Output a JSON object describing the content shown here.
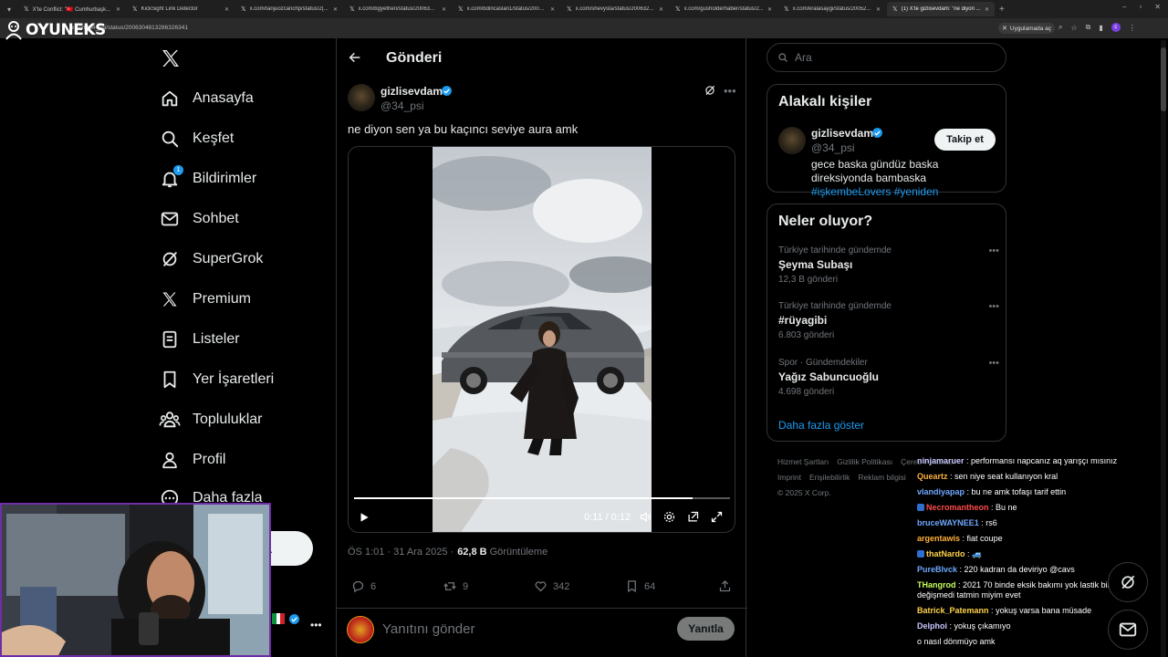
{
  "browser": {
    "tabs": [
      {
        "title": "X'te Conflict: \"🇹🇷 Cumhurbaşk...",
        "active": false
      },
      {
        "title": "KickSight Link Detector",
        "active": false
      },
      {
        "title": "x.com/tanjuozcanchp/status/2(...",
        "active": false
      },
      {
        "title": "x.com/bgyetheri/status/20063...",
        "active": false
      },
      {
        "title": "x.com/bdincaslan1/status/2006...",
        "active": false
      },
      {
        "title": "x.com/shevysta/status/200632...",
        "active": false
      },
      {
        "title": "x.com/gusholderhaber/status/2...",
        "active": false
      },
      {
        "title": "x.com/kralasaygi/status/20052...",
        "active": false
      },
      {
        "title": "(1) X'te gizlisevdam: \"ne diyon ...",
        "active": true
      }
    ],
    "url": "x.com/34_psi/status/2006304813286326341",
    "app_chip": "Uygulamada aç"
  },
  "stream": {
    "logo_text": "OYUNEKS"
  },
  "nav": {
    "items": [
      {
        "label": "Anasayfa",
        "icon": "home-icon"
      },
      {
        "label": "Keşfet",
        "icon": "search-icon"
      },
      {
        "label": "Bildirimler",
        "icon": "bell-icon",
        "badge": "1"
      },
      {
        "label": "Sohbet",
        "icon": "mail-icon"
      },
      {
        "label": "SuperGrok",
        "icon": "grok-icon"
      },
      {
        "label": "Premium",
        "icon": "x-icon"
      },
      {
        "label": "Listeler",
        "icon": "list-icon"
      },
      {
        "label": "Yer İşaretleri",
        "icon": "bookmark-icon"
      },
      {
        "label": "Topluluklar",
        "icon": "communities-icon"
      },
      {
        "label": "Profil",
        "icon": "profile-icon"
      },
      {
        "label": "Daha fazla",
        "icon": "more-circle-icon"
      }
    ],
    "post_button_partial": "a",
    "account_more": "•••"
  },
  "post": {
    "header_title": "Gönderi",
    "author_name": "gizlisevdam",
    "author_handle": "@34_psi",
    "text": "ne diyon sen ya bu kaçıncı seviye aura amk",
    "video": {
      "current_time": "0:11",
      "separator": "/",
      "duration": "0:12",
      "progress": 0.9
    },
    "time": "ÖS 1:01 · 31 Ara 2025 ·",
    "views": "62,8 B",
    "views_label": "Görüntüleme",
    "stats": {
      "replies": "6",
      "reposts": "9",
      "likes": "342",
      "bookmarks": "64"
    },
    "reply_placeholder": "Yanıtını gönder",
    "reply_button": "Yanıtla"
  },
  "sidebar": {
    "search_placeholder": "Ara",
    "related_title": "Alakalı kişiler",
    "related": {
      "name": "gizlisevdam",
      "handle": "@34_psi",
      "follow_label": "Takip et",
      "bio_text": "gece baska gündüz baska direksiyonda bambaska ",
      "bio_tag1": "#işkembeLovers",
      "bio_tag2": "#yeniden"
    },
    "trends_title": "Neler oluyor?",
    "trends": [
      {
        "context": "Türkiye tarihinde gündemde",
        "name": "Şeyma Subaşı",
        "count": "12,3 B gönderi"
      },
      {
        "context": "Türkiye tarihinde gündemde",
        "name": "#rüyagibi",
        "count": "6.803 gönderi"
      },
      {
        "context": "Spor · Gündemdekiler",
        "name": "Yağız Sabuncuoğlu",
        "count": "4.698 gönderi"
      }
    ],
    "show_more": "Daha fazla göster",
    "footer": {
      "terms": "Hizmet Şartları",
      "privacy": "Gizlilik Politikası",
      "cookie": "Çerez Politikası",
      "imprint": "Imprint",
      "accessibility": "Erişilebilirlik",
      "ads": "Reklam bilgisi",
      "copyright": "© 2025 X Corp."
    }
  },
  "chat": [
    {
      "user": "ninjamaruer",
      "color": "#c8c8ff",
      "msg": "performansı napcanız aq yarışçı mısınız"
    },
    {
      "user": "Queartz",
      "color": "#ffb03a",
      "msg": "sen niye seat kullanıyon kral"
    },
    {
      "user": "vlandiyapap",
      "color": "#6fa8ff",
      "msg": "bu ne amk tofaşı tarif ettin"
    },
    {
      "user": "Necromantheon",
      "color": "#ff4a4a",
      "msg": "Bu ne",
      "badge": "#2f6fd0"
    },
    {
      "user": "bruceWAYNEE1",
      "color": "#6fa8ff",
      "msg": "rs6"
    },
    {
      "user": "argentawis",
      "color": "#ffb03a",
      "msg": "fiat coupe"
    },
    {
      "user": "thatNardo",
      "color": "#ffd24a",
      "msg": "🚙",
      "badge": "#2f6fd0"
    },
    {
      "user": "PureBlvck",
      "color": "#6fa8ff",
      "msg": "220 kadran da deviriyo @cavs"
    },
    {
      "user": "THangrod",
      "color": "#c8ff5a",
      "msg": "2021 70 binde eksik bakımı yok lastik bile değişmedi tatmin miyim evet"
    },
    {
      "user": "Batrick_Patemann",
      "color": "#ffd24a",
      "msg": "yokuş varsa bana müsade"
    },
    {
      "user": "Delphoi",
      "color": "#c8c8ff",
      "msg": "yokuş çıkamıyo"
    },
    {
      "user": "",
      "color": "#ffffff",
      "msg": "o nasıl dönmüyo amk"
    }
  ],
  "colors": {
    "accent": "#1d9bf0",
    "background": "#000000",
    "border": "#2f3336",
    "muted": "#71767b",
    "webcam_border": "#6f2da8"
  }
}
